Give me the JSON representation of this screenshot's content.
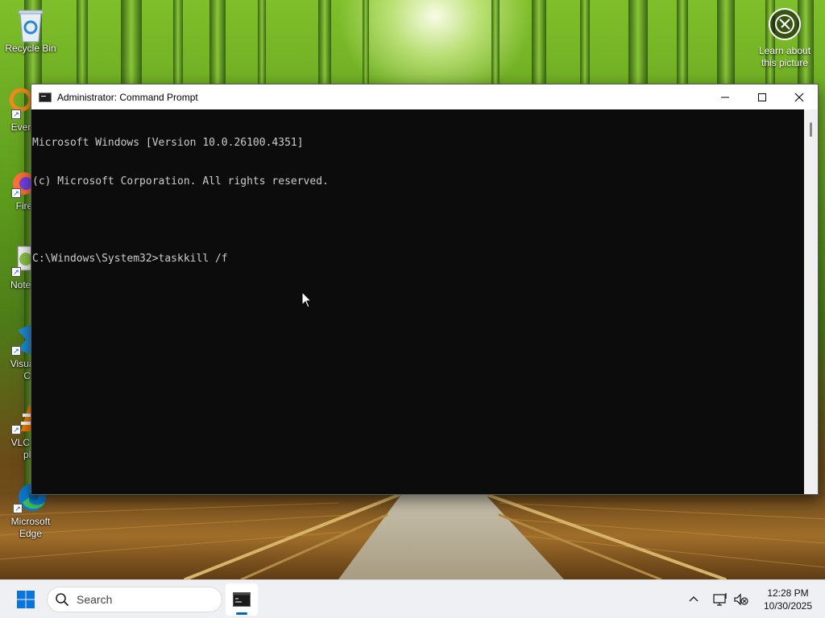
{
  "desktop": {
    "icons": [
      {
        "label": "Recycle Bin"
      },
      {
        "label": "Every"
      },
      {
        "label": "Fire"
      },
      {
        "label": "Notep"
      },
      {
        "label_line1": "Visual",
        "label_line2": "Co"
      },
      {
        "label_line1": "VLC r",
        "label_line2": "pla"
      },
      {
        "label_line1": "Microsoft",
        "label_line2": "Edge"
      }
    ],
    "learn_line1": "Learn about",
    "learn_line2": "this picture"
  },
  "window": {
    "title": "Administrator: Command Prompt",
    "console_lines": [
      "Microsoft Windows [Version 10.0.26100.4351]",
      "(c) Microsoft Corporation. All rights reserved.",
      "",
      "C:\\Windows\\System32>taskkill /f"
    ]
  },
  "taskbar": {
    "search_placeholder": "Search",
    "time": "12:28 PM",
    "date": "10/30/2025"
  },
  "colors": {
    "console_bg": "#0c0c0c",
    "console_fg": "#cccccc",
    "accent": "#0067c0",
    "taskbar_bg": "#eef0f3"
  }
}
